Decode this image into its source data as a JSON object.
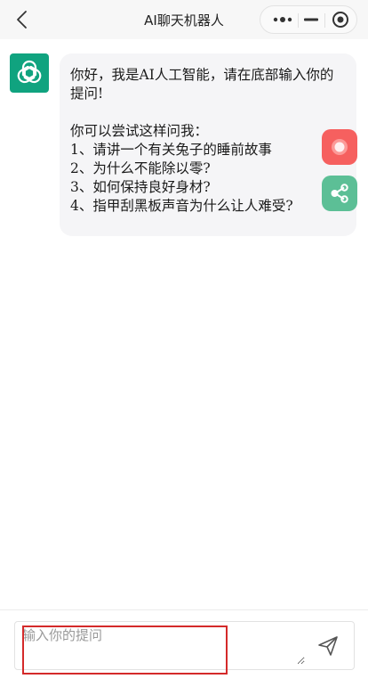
{
  "header": {
    "title": "AI聊天机器人"
  },
  "chat": {
    "bot_message": {
      "line1": "你好，我是AI人工智能，请在底部输入你的提问!",
      "line2": "你可以尝试这样问我：",
      "suggestions": [
        "1、请讲一个有关兔子的睡前故事",
        "2、为什么不能除以零?",
        "3、如何保持良好身材?",
        "4、指甲刮黑板声音为什么让人难受?"
      ]
    }
  },
  "input": {
    "placeholder": "输入你的提问",
    "value": ""
  },
  "icons": {
    "back": "chevron-left-icon",
    "more": "more-dots-icon",
    "minimize": "minus-icon",
    "close": "target-icon",
    "avatar": "openai-logo-icon",
    "red_fab": "record-icon",
    "green_fab": "share-icon",
    "send": "send-icon"
  },
  "colors": {
    "avatar_bg": "#10a37f",
    "red_fab": "#f6605f",
    "green_fab": "#5cbf96",
    "highlight": "#d42a2a"
  }
}
